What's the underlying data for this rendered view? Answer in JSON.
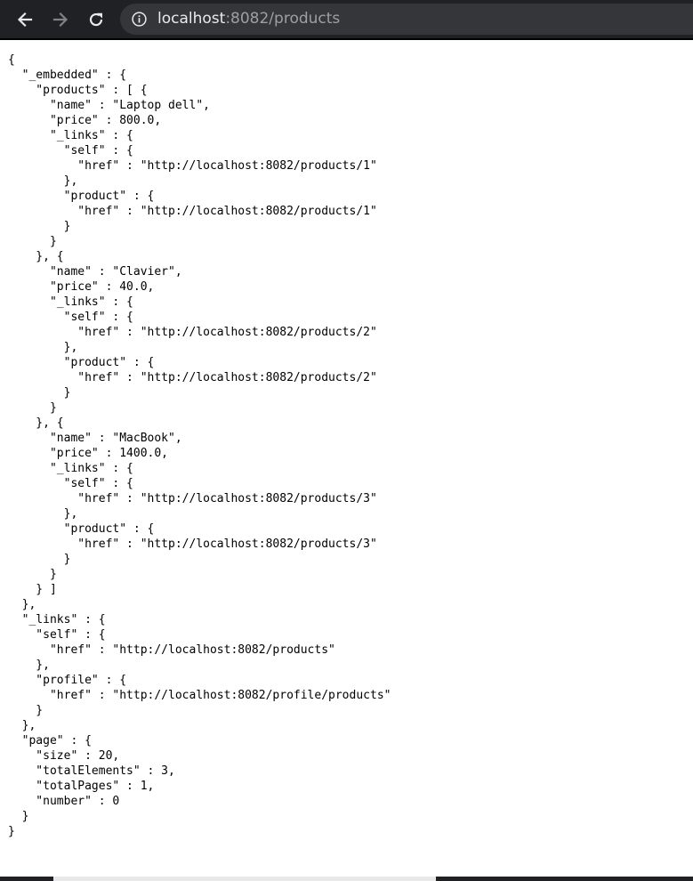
{
  "address_bar": {
    "host": "localhost",
    "rest": ":8082/products"
  },
  "icons": {
    "back": "back-arrow-icon",
    "forward": "forward-arrow-icon",
    "reload": "reload-icon",
    "site_info": "info-icon"
  },
  "colors": {
    "toolbar": "#202124",
    "omnibox": "#35363a",
    "host_text": "#e8eaed",
    "path_text": "#9aa0a6"
  },
  "json_lines": [
    "{",
    "  \"_embedded\" : {",
    "    \"products\" : [ {",
    "      \"name\" : \"Laptop dell\",",
    "      \"price\" : 800.0,",
    "      \"_links\" : {",
    "        \"self\" : {",
    "          \"href\" : \"http://localhost:8082/products/1\"",
    "        },",
    "        \"product\" : {",
    "          \"href\" : \"http://localhost:8082/products/1\"",
    "        }",
    "      }",
    "    }, {",
    "      \"name\" : \"Clavier\",",
    "      \"price\" : 40.0,",
    "      \"_links\" : {",
    "        \"self\" : {",
    "          \"href\" : \"http://localhost:8082/products/2\"",
    "        },",
    "        \"product\" : {",
    "          \"href\" : \"http://localhost:8082/products/2\"",
    "        }",
    "      }",
    "    }, {",
    "      \"name\" : \"MacBook\",",
    "      \"price\" : 1400.0,",
    "      \"_links\" : {",
    "        \"self\" : {",
    "          \"href\" : \"http://localhost:8082/products/3\"",
    "        },",
    "        \"product\" : {",
    "          \"href\" : \"http://localhost:8082/products/3\"",
    "        }",
    "      }",
    "    } ]",
    "  },",
    "  \"_links\" : {",
    "    \"self\" : {",
    "      \"href\" : \"http://localhost:8082/products\"",
    "    },",
    "    \"profile\" : {",
    "      \"href\" : \"http://localhost:8082/profile/products\"",
    "    }",
    "  },",
    "  \"page\" : {",
    "    \"size\" : 20,",
    "    \"totalElements\" : 3,",
    "    \"totalPages\" : 1,",
    "    \"number\" : 0",
    "  }",
    "}"
  ]
}
